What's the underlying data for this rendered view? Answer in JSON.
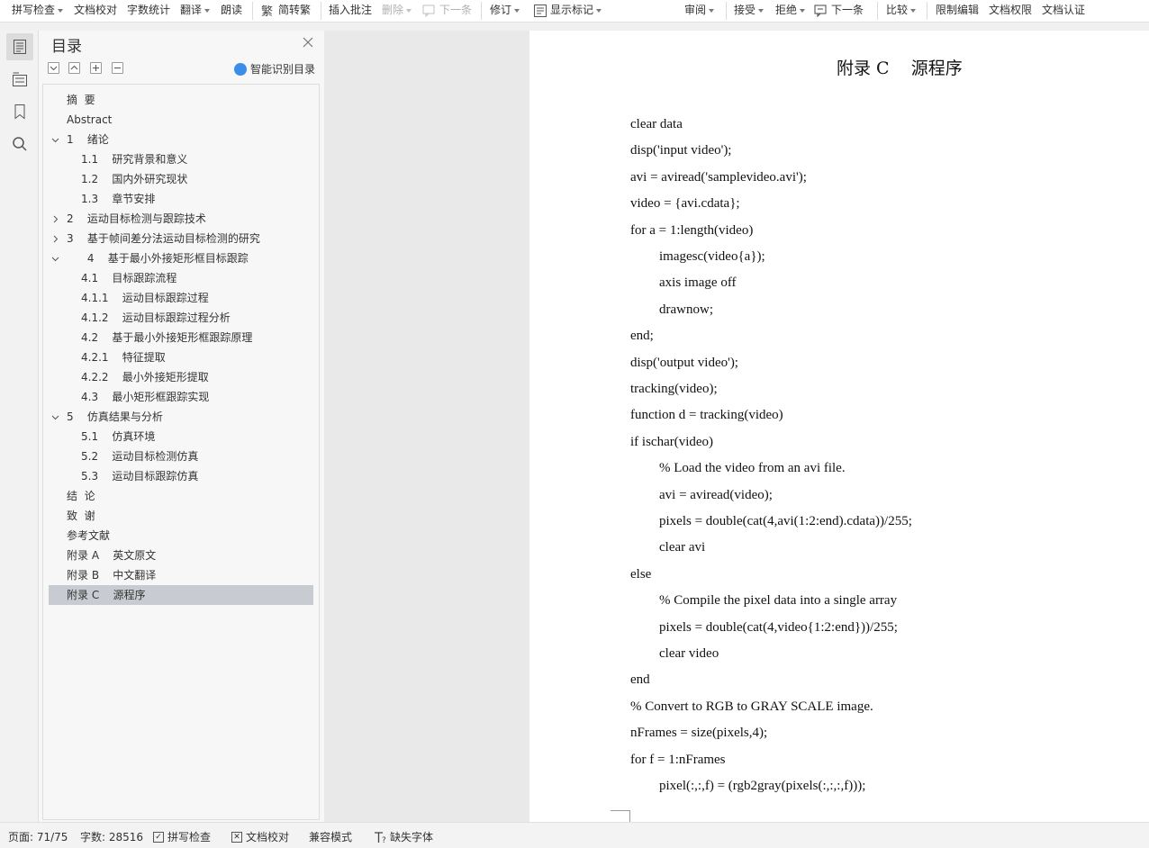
{
  "toolbar": {
    "spell_check": "拼写检查",
    "doc_proof": "文档校对",
    "word_count": "字数统计",
    "translate": "翻译",
    "read_aloud": "朗读",
    "convert_simple": "简转繁",
    "insert_comment": "插入批注",
    "delete": "删除",
    "next_comment": "下一条",
    "revise": "修订",
    "show_marks": "显示标记",
    "review": "审阅",
    "accept": "接受",
    "reject": "拒绝",
    "next_change": "下一条",
    "compare": "比较",
    "restrict_edit": "限制编辑",
    "doc_permission": "文档权限",
    "doc_cert": "文档认证"
  },
  "toc": {
    "title": "目录",
    "smart_label": "智能识别目录",
    "items": [
      {
        "text": "摘  要"
      },
      {
        "text": "Abstract"
      },
      {
        "text": "1    绪论",
        "chevron": "down"
      },
      {
        "text": "1.1    研究背景和意义"
      },
      {
        "text": "1.2    国内外研究现状"
      },
      {
        "text": "1.3    章节安排"
      },
      {
        "text": "2    运动目标检测与跟踪技术",
        "chevron": "right"
      },
      {
        "text": "3    基于帧间差分法运动目标检测的研究",
        "chevron": "right"
      },
      {
        "text": "      4    基于最小外接矩形框目标跟踪",
        "chevron": "down"
      },
      {
        "text": "4.1    目标跟踪流程"
      },
      {
        "text": "4.1.1    运动目标跟踪过程"
      },
      {
        "text": "4.1.2    运动目标跟踪过程分析"
      },
      {
        "text": "4.2    基于最小外接矩形框跟踪原理"
      },
      {
        "text": "4.2.1    特征提取"
      },
      {
        "text": "4.2.2    最小外接矩形提取"
      },
      {
        "text": "4.3    最小矩形框跟踪实现"
      },
      {
        "text": "5    仿真结果与分析",
        "chevron": "down"
      },
      {
        "text": "5.1    仿真环境"
      },
      {
        "text": "5.2    运动目标检测仿真"
      },
      {
        "text": "5.3    运动目标跟踪仿真"
      },
      {
        "text": "结  论"
      },
      {
        "text": "致  谢"
      },
      {
        "text": "参考文献"
      },
      {
        "text": "附录 A    英文原文"
      },
      {
        "text": "附录 B    中文翻译"
      },
      {
        "text": "附录 C    源程序",
        "selected": true
      }
    ]
  },
  "document": {
    "title": "附录 C    源程序",
    "lines": [
      {
        "text": "clear data",
        "indent": 0
      },
      {
        "text": "disp('input video');",
        "indent": 0
      },
      {
        "text": "avi = aviread('samplevideo.avi');",
        "indent": 0
      },
      {
        "text": "video = {avi.cdata};",
        "indent": 0
      },
      {
        "text": "for a = 1:length(video)",
        "indent": 0
      },
      {
        "text": "imagesc(video{a});",
        "indent": 1
      },
      {
        "text": "axis image off",
        "indent": 1
      },
      {
        "text": "drawnow;",
        "indent": 1
      },
      {
        "text": "end;",
        "indent": 0
      },
      {
        "text": "disp('output video');",
        "indent": 0
      },
      {
        "text": "tracking(video);",
        "indent": 0
      },
      {
        "text": "function d = tracking(video)",
        "indent": 0
      },
      {
        "text": "if ischar(video)",
        "indent": 0
      },
      {
        "text": "% Load the video from an avi file.",
        "indent": 1
      },
      {
        "text": "avi = aviread(video);",
        "indent": 1
      },
      {
        "text": "pixels = double(cat(4,avi(1:2:end).cdata))/255;",
        "indent": 1
      },
      {
        "text": "clear avi",
        "indent": 1
      },
      {
        "text": "else",
        "indent": 0
      },
      {
        "text": "% Compile the pixel data into a single array",
        "indent": 1
      },
      {
        "text": "pixels = double(cat(4,video{1:2:end}))/255;",
        "indent": 1
      },
      {
        "text": "clear video",
        "indent": 1
      },
      {
        "text": "end",
        "indent": 0
      },
      {
        "text": "% Convert to RGB to GRAY SCALE image.",
        "indent": 0
      },
      {
        "text": "nFrames = size(pixels,4);",
        "indent": 0
      },
      {
        "text": "for f = 1:nFrames",
        "indent": 0
      },
      {
        "text": "pixel(:,:,f) = (rgb2gray(pixels(:,:,:,f)));",
        "indent": 1
      }
    ]
  },
  "status": {
    "page": "页面: 71/75",
    "words": "字数: 28516",
    "spell_check": "拼写检查",
    "doc_proof": "文档校对",
    "compat_mode": "兼容模式",
    "missing_fonts": "缺失字体"
  },
  "colors": {
    "selected_item": "#c8ccd2",
    "smart_icon": "#3b8ee8",
    "page_bg": "#ffffff",
    "workspace_bg": "#e9e9e9"
  }
}
